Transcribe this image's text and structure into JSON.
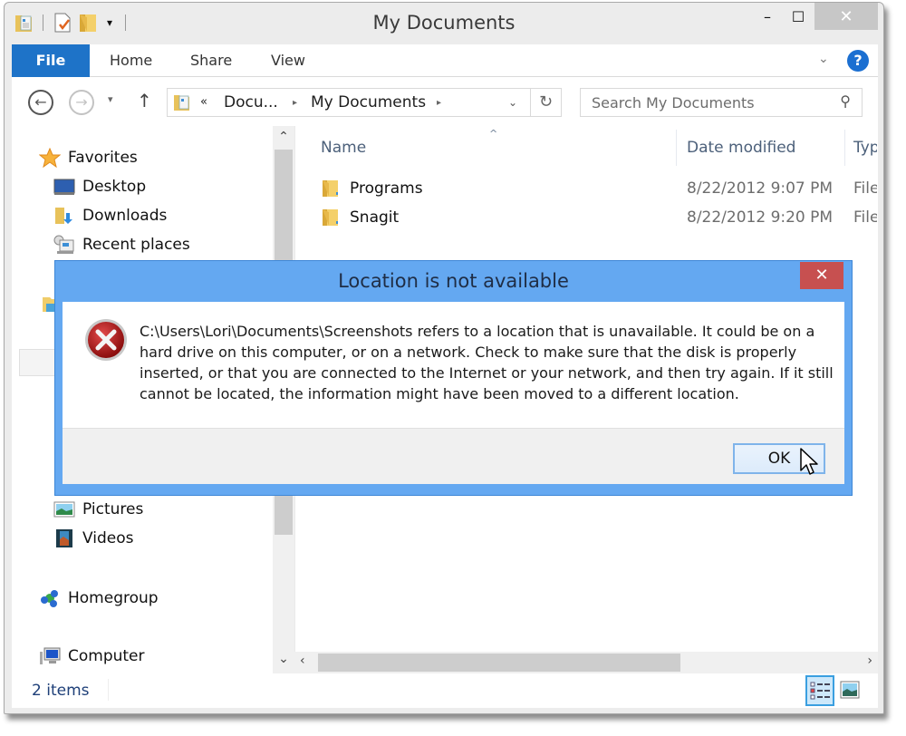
{
  "window": {
    "title": "My Documents",
    "controls": {
      "minimize": "–",
      "maximize": "☐",
      "close": "✕"
    }
  },
  "quick_access": {
    "items": [
      "properties-icon",
      "new-document-icon",
      "new-folder-icon"
    ],
    "customize": "▾"
  },
  "ribbon": {
    "tabs": [
      {
        "label": "File"
      },
      {
        "label": "Home"
      },
      {
        "label": "Share"
      },
      {
        "label": "View"
      }
    ],
    "expand": "⌄",
    "help": "?"
  },
  "navigation": {
    "back": "←",
    "forward": "→",
    "recent": "▾",
    "up": "↑",
    "breadcrumb": {
      "overflow": "«",
      "items": [
        "Docu...",
        "My Documents"
      ],
      "separator": "▸",
      "dropdown": "⌄",
      "refresh": "↻"
    },
    "search": {
      "placeholder": "Search My Documents",
      "value": "",
      "icon": "⚲"
    }
  },
  "nav_pane": {
    "favorites": {
      "label": "Favorites",
      "items": [
        {
          "label": "Desktop"
        },
        {
          "label": "Downloads"
        },
        {
          "label": "Recent places"
        }
      ]
    },
    "libraries_visible": [
      {
        "label": "Pictures"
      },
      {
        "label": "Videos"
      }
    ],
    "homegroup": {
      "label": "Homegroup"
    },
    "computer": {
      "label": "Computer"
    },
    "scroll_up": "⌃",
    "scroll_down": "⌄"
  },
  "file_list": {
    "columns": [
      {
        "label": "Name"
      },
      {
        "label": "Date modified"
      },
      {
        "label": "Type"
      }
    ],
    "sort_indicator": "^",
    "rows": [
      {
        "name": "Programs",
        "date": "8/22/2012 9:07 PM",
        "type": "File folder"
      },
      {
        "name": "Snagit",
        "date": "8/22/2012 9:20 PM",
        "type": "File folder"
      }
    ],
    "scroll_left": "‹",
    "scroll_right": "›"
  },
  "status_bar": {
    "items_count": "2 items"
  },
  "dialog": {
    "title": "Location is not available",
    "close": "✕",
    "message": "C:\\Users\\Lori\\Documents\\Screenshots refers to a location that is unavailable. It could be on a hard drive on this computer, or on a network. Check to make sure that the disk is properly inserted, or that you are connected to the Internet or your network, and then try again. If it still cannot be located, the information might have been moved to a different location.",
    "ok_label": "OK"
  },
  "colors": {
    "file_tab": "#1e73c8",
    "dialog_frame": "#64a8f1",
    "dialog_close": "#c75050",
    "help": "#1b6fd1",
    "column_header": "#4c607a",
    "status_text": "#1e3f78"
  }
}
